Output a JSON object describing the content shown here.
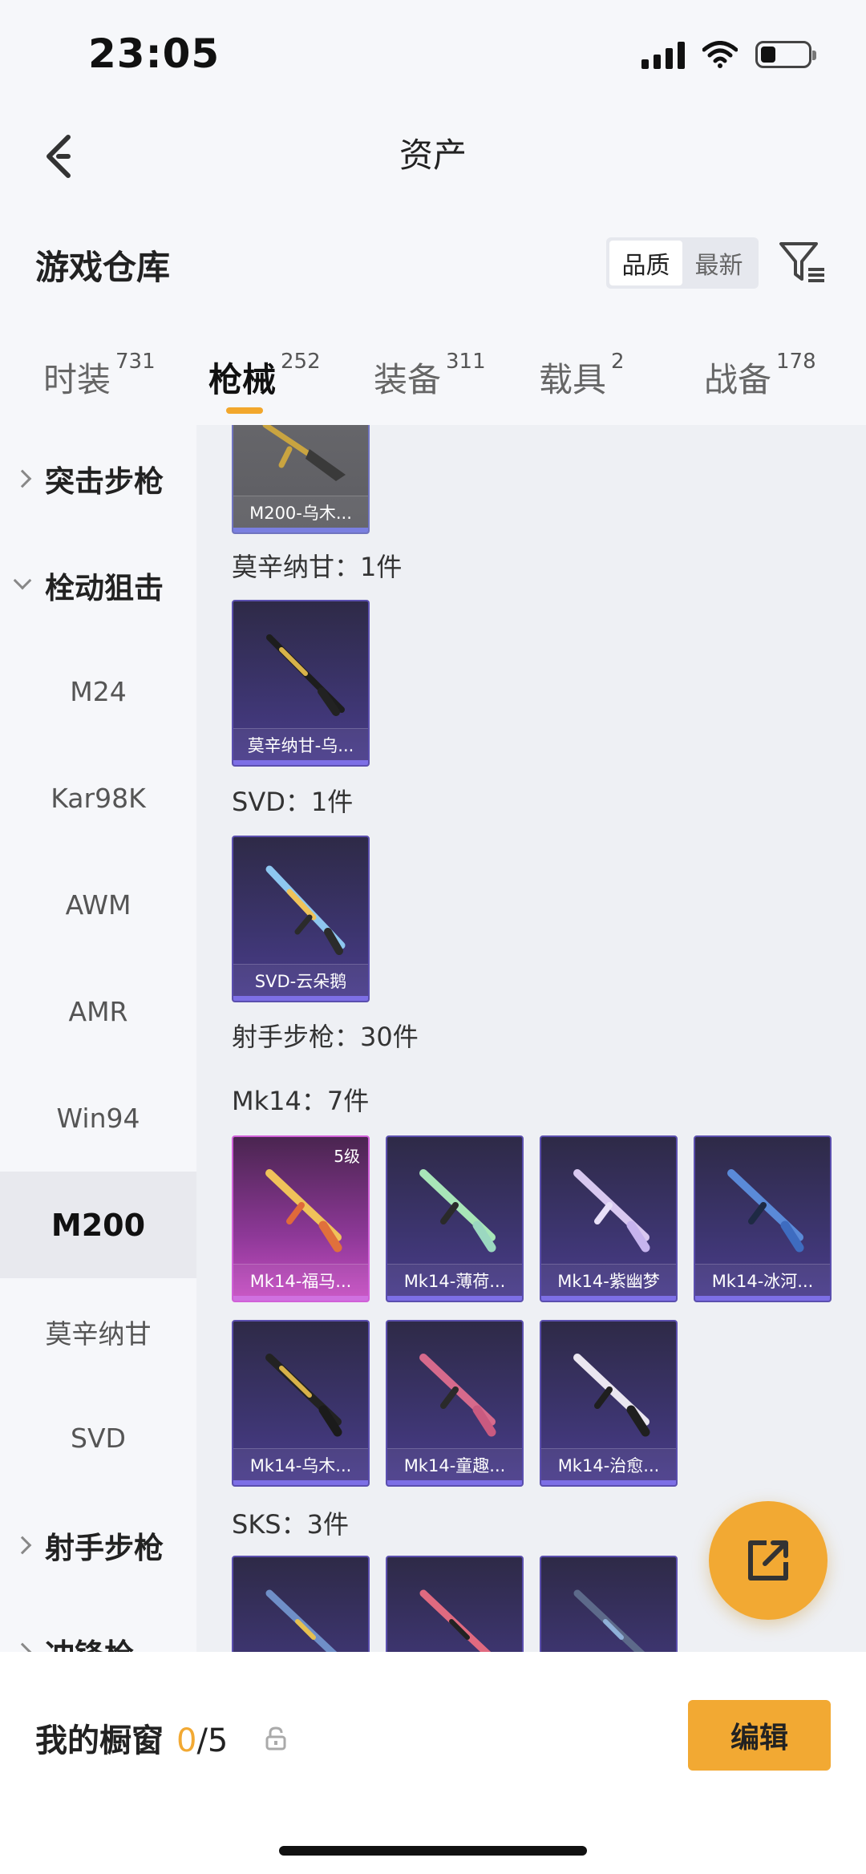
{
  "status": {
    "time": "23:05"
  },
  "nav": {
    "title": "资产"
  },
  "warehouse": {
    "title": "游戏仓库",
    "sort_options": [
      "品质",
      "最新"
    ],
    "sort_selected": "品质"
  },
  "tabs": [
    {
      "label": "时装",
      "count": "731"
    },
    {
      "label": "枪械",
      "count": "252",
      "active": true
    },
    {
      "label": "装备",
      "count": "311"
    },
    {
      "label": "载具",
      "count": "2"
    },
    {
      "label": "战备",
      "count": "178"
    }
  ],
  "sidebar": {
    "items": [
      {
        "label": "突击步枪",
        "type": "group",
        "expanded": false
      },
      {
        "label": "栓动狙击",
        "type": "group",
        "expanded": true
      },
      {
        "label": "M24"
      },
      {
        "label": "Kar98K"
      },
      {
        "label": "AWM"
      },
      {
        "label": "AMR"
      },
      {
        "label": "Win94"
      },
      {
        "label": "M200",
        "selected": true
      },
      {
        "label": "莫辛纳甘"
      },
      {
        "label": "SVD"
      },
      {
        "label": "射手步枪",
        "type": "group",
        "expanded": false
      },
      {
        "label": "冲锋枪",
        "type": "group",
        "expanded": false
      }
    ]
  },
  "content": {
    "sections": [
      {
        "label": ""
      },
      {
        "label": "莫辛纳甘：1件"
      },
      {
        "label": "SVD：1件"
      },
      {
        "label": "射手步枪：30件"
      },
      {
        "label": "Mk14：7件"
      },
      {
        "label": "SKS：3件"
      }
    ],
    "cards": {
      "m200": [
        {
          "label": "M200-乌木..."
        }
      ],
      "mosin": [
        {
          "label": "莫辛纳甘-乌..."
        }
      ],
      "svd": [
        {
          "label": "SVD-云朵鹅"
        }
      ],
      "mk14": [
        {
          "label": "Mk14-福马...",
          "level": "5级"
        },
        {
          "label": "Mk14-薄荷..."
        },
        {
          "label": "Mk14-紫幽梦"
        },
        {
          "label": "Mk14-冰河..."
        },
        {
          "label": "Mk14-乌木..."
        },
        {
          "label": "Mk14-童趣..."
        },
        {
          "label": "Mk14-治愈..."
        }
      ]
    }
  },
  "bottom": {
    "showcase_label": "我的橱窗",
    "showcase_current": "0",
    "showcase_total": "/5",
    "edit_label": "编辑"
  },
  "colors": {
    "accent": "#f2a933",
    "tab_underline": "#f2a72c"
  }
}
